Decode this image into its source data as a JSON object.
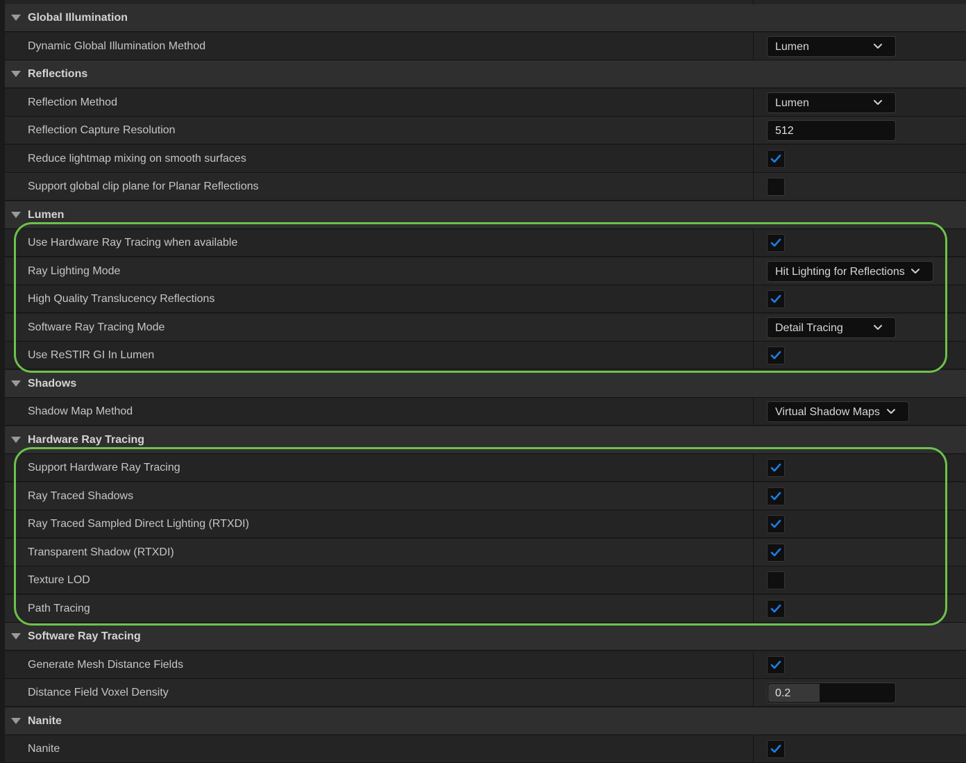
{
  "colors": {
    "highlight": "#6cc24a",
    "checkmark": "#1a7fe6",
    "section_bg": "#2f2f2f",
    "row_bg": "#242424"
  },
  "sections": [
    {
      "label": "Global Illumination",
      "properties": [
        {
          "label": "Dynamic Global Illumination Method",
          "type": "dropdown",
          "value": "Lumen"
        }
      ]
    },
    {
      "label": "Reflections",
      "properties": [
        {
          "label": "Reflection Method",
          "type": "dropdown",
          "value": "Lumen"
        },
        {
          "label": "Reflection Capture Resolution",
          "type": "number",
          "value": "512"
        },
        {
          "label": "Reduce lightmap mixing on smooth surfaces",
          "type": "checkbox",
          "checked": true
        },
        {
          "label": "Support global clip plane for Planar Reflections",
          "type": "checkbox",
          "checked": false
        }
      ]
    },
    {
      "label": "Lumen",
      "highlighted": true,
      "properties": [
        {
          "label": "Use Hardware Ray Tracing when available",
          "type": "checkbox",
          "checked": true
        },
        {
          "label": "Ray Lighting Mode",
          "type": "dropdown",
          "value": "Hit Lighting for Reflections"
        },
        {
          "label": "High Quality Translucency Reflections",
          "type": "checkbox",
          "checked": true
        },
        {
          "label": "Software Ray Tracing Mode",
          "type": "dropdown",
          "value": "Detail Tracing"
        },
        {
          "label": "Use ReSTIR GI In Lumen",
          "type": "checkbox",
          "checked": true
        }
      ]
    },
    {
      "label": "Shadows",
      "properties": [
        {
          "label": "Shadow Map Method",
          "type": "dropdown",
          "value": "Virtual Shadow Maps"
        }
      ]
    },
    {
      "label": "Hardware Ray Tracing",
      "highlighted": true,
      "properties": [
        {
          "label": "Support Hardware Ray Tracing",
          "type": "checkbox",
          "checked": true
        },
        {
          "label": "Ray Traced Shadows",
          "type": "checkbox",
          "checked": true
        },
        {
          "label": "Ray Traced Sampled Direct Lighting (RTXDI)",
          "type": "checkbox",
          "checked": true
        },
        {
          "label": "Transparent Shadow (RTXDI)",
          "type": "checkbox",
          "checked": true
        },
        {
          "label": "Texture LOD",
          "type": "checkbox",
          "checked": false
        },
        {
          "label": "Path Tracing",
          "type": "checkbox",
          "checked": true
        }
      ]
    },
    {
      "label": "Software Ray Tracing",
      "properties": [
        {
          "label": "Generate Mesh Distance Fields",
          "type": "checkbox",
          "checked": true
        },
        {
          "label": "Distance Field Voxel Density",
          "type": "slider",
          "value": "0.2",
          "fraction": 0.4
        }
      ]
    },
    {
      "label": "Nanite",
      "properties": [
        {
          "label": "Nanite",
          "type": "checkbox",
          "checked": true
        }
      ]
    }
  ]
}
